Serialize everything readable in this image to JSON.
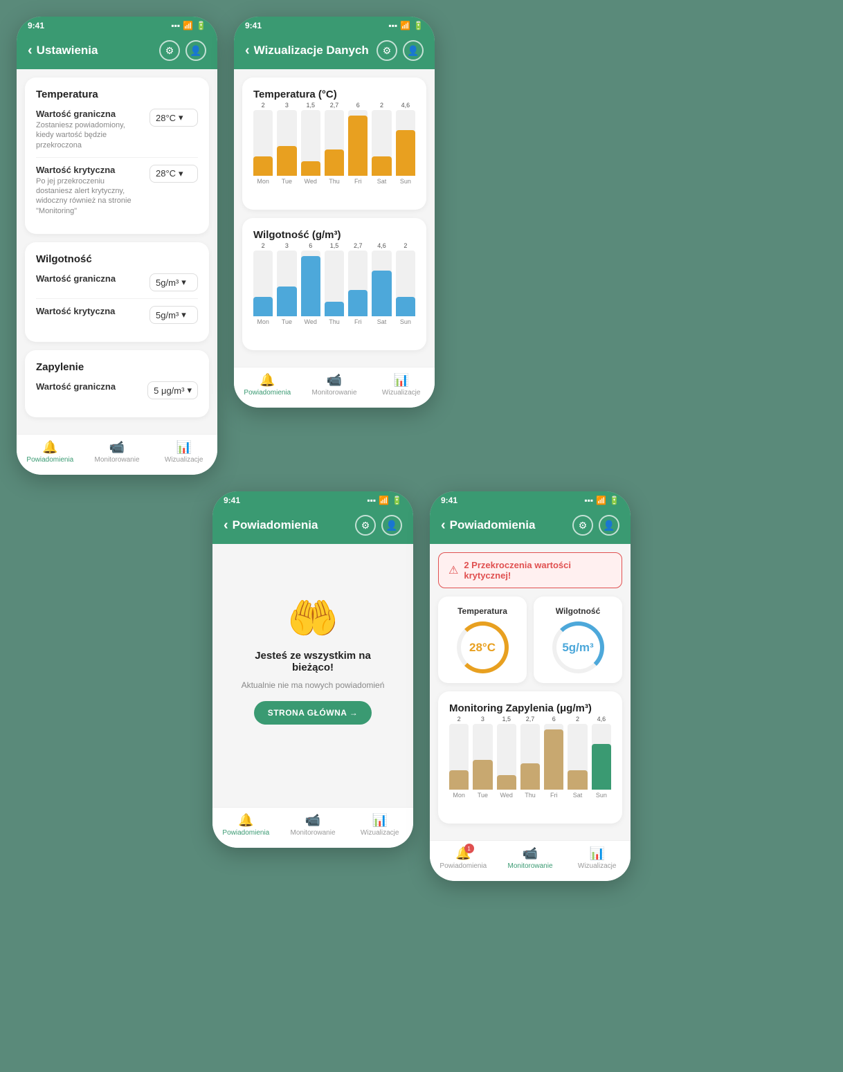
{
  "screens": {
    "settings": {
      "status_time": "9:41",
      "title": "Ustawienia",
      "back": "‹",
      "sections": [
        {
          "name": "Temperatura",
          "fields": [
            {
              "label": "Wartość graniczna",
              "desc": "Zostaniesz powiadomiony, kiedy wartość będzie przekroczona",
              "value": "28°C"
            },
            {
              "label": "Wartość krytyczna",
              "desc": "Po jej przekroczeniu dostaniesz alert krytyczny, widoczny również na stronie \"Monitoring\"",
              "value": "28°C"
            }
          ]
        },
        {
          "name": "Wilgotność",
          "fields": [
            {
              "label": "Wartość graniczna",
              "desc": "",
              "value": "5g/m³"
            },
            {
              "label": "Wartość krytyczna",
              "desc": "",
              "value": "5g/m³"
            }
          ]
        },
        {
          "name": "Zapylenie",
          "fields": [
            {
              "label": "Wartość graniczna",
              "desc": "",
              "value": "5 μg/m³"
            }
          ]
        }
      ],
      "nav": [
        {
          "label": "Powiadomienia",
          "active": true,
          "icon": "🔔"
        },
        {
          "label": "Monitorowanie",
          "active": false,
          "icon": "📹"
        },
        {
          "label": "Wizualizacje",
          "active": false,
          "icon": "📊"
        }
      ]
    },
    "visualization": {
      "status_time": "9:41",
      "title": "Wizualizacje Danych",
      "temp_chart": {
        "title": "Temperatura (°C)",
        "values": [
          2,
          3,
          1.5,
          2.7,
          6,
          2,
          4.6
        ],
        "labels": [
          "Mon",
          "Tue",
          "Wed",
          "Thu",
          "Fri",
          "Sat",
          "Sun"
        ],
        "color": "#e8a020"
      },
      "humidity_chart": {
        "title": "Wilgotność (g/m³)",
        "values": [
          2,
          3,
          6,
          1.5,
          2.7,
          4.6,
          2
        ],
        "labels": [
          "Mon",
          "Tue",
          "Wed",
          "Thu",
          "Fri",
          "Sat",
          "Sun"
        ],
        "color": "#4da8da"
      },
      "nav": [
        {
          "label": "Powiadomienia",
          "active": true,
          "icon": "🔔"
        },
        {
          "label": "Monitorowanie",
          "active": false,
          "icon": "📹"
        },
        {
          "label": "Wizualizacje",
          "active": false,
          "icon": "📊"
        }
      ]
    },
    "notifications_empty": {
      "status_time": "9:41",
      "title": "Powiadomienia",
      "empty_title": "Jesteś ze wszystkim na bieżąco!",
      "empty_sub": "Aktualnie nie ma nowych powiadomień",
      "btn_label": "STRONA GŁÓWNA →",
      "nav": [
        {
          "label": "Powiadomienia",
          "active": true,
          "icon": "🔔"
        },
        {
          "label": "Monitorowanie",
          "active": false,
          "icon": "📹"
        },
        {
          "label": "Wizualizacje",
          "active": false,
          "icon": "📊"
        }
      ]
    },
    "notifications_alert": {
      "status_time": "9:41",
      "title": "Powiadomienia",
      "alert_text": "⚠ 2 Przekroczenia wartości krytycznej!",
      "temp_label": "Temperatura",
      "temp_value": "28°C",
      "humidity_label": "Wilgotność",
      "humidity_value": "5g/m³",
      "dust_chart": {
        "title": "Monitoring Zapylenia (μg/m³)",
        "values": [
          2,
          3,
          1.5,
          2.7,
          6,
          2,
          4.6
        ],
        "labels": [
          "Mon",
          "Tue",
          "Wed",
          "Thu",
          "Fri",
          "Sat",
          "Sun"
        ],
        "color": "#c8a870",
        "highlight_index": 6,
        "highlight_color": "#3a9a72"
      },
      "nav": [
        {
          "label": "Powiadomienia",
          "active": false,
          "icon": "🔔",
          "badge": "1"
        },
        {
          "label": "Monitorowanie",
          "active": true,
          "icon": "📹"
        },
        {
          "label": "Wizualizacje",
          "active": false,
          "icon": "📊"
        }
      ]
    }
  }
}
